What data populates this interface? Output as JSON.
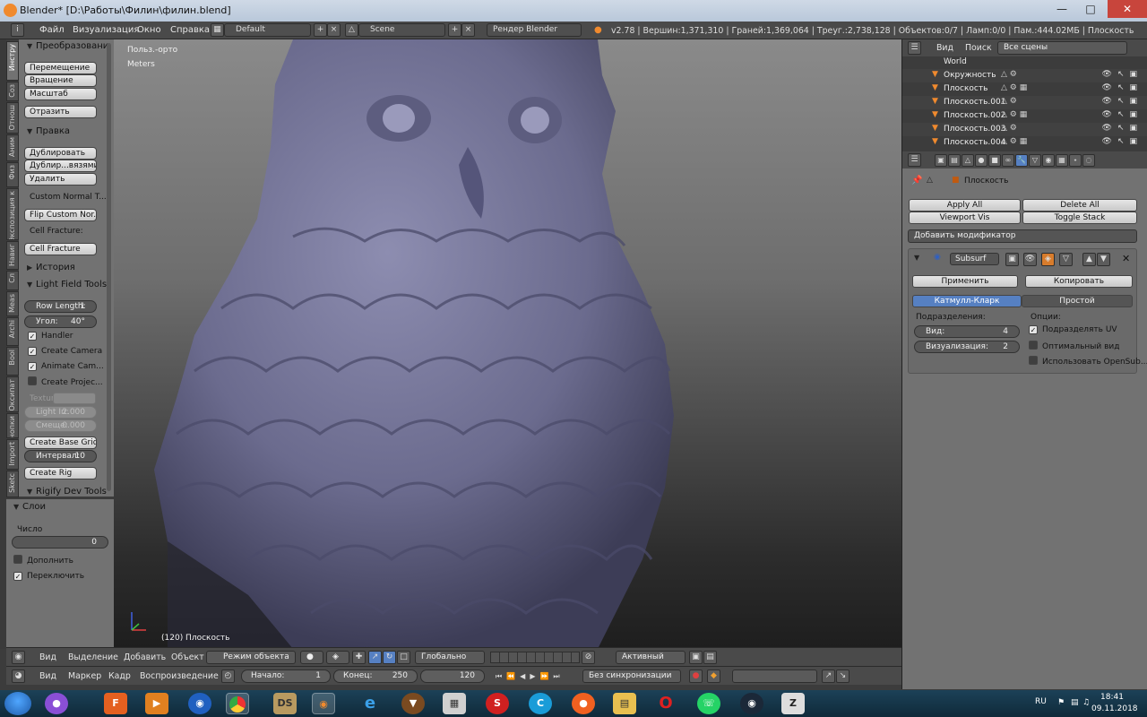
{
  "window": {
    "title": "Blender* [D:\\Работы\\Филин\\филин.blend]"
  },
  "menubar": {
    "items": [
      "Файл",
      "Визуализация",
      "Окно",
      "Справка"
    ],
    "layout": "Default",
    "scene": "Scene",
    "engine": "Рендер Blender",
    "info": "v2.78 | Вершин:1,371,310 | Граней:1,369,064 | Треуг.:2,738,128 | Объектов:0/7 | Ламп:0/0 | Пам.:444.02МБ | Плоскость"
  },
  "tabs": [
    "Инстру",
    "Соз",
    "Отнош",
    "Аним",
    "Физ",
    "Экспозиция к",
    "Навиг",
    "Сл",
    "Meas",
    "Archi",
    "Bool",
    "Оксипат",
    "Кнопки",
    "Import",
    "Sketc"
  ],
  "toolshelf": {
    "transform_header": "Преобразовани",
    "move": "Перемещение",
    "rotate": "Вращение",
    "scale": "Масштаб",
    "mirror": "Отразить",
    "edit_header": "Правка",
    "duplicate": "Дублировать",
    "duplicate_linked": "Дублир...вязями",
    "delete": "Удалить",
    "custom_normal": "Custom Normal T...",
    "flip_normal": "Flip Custom Nor...",
    "cell_fracture_label": "Cell Fracture:",
    "cell_fracture": "Cell Fracture",
    "history_header": "История",
    "lightfield_header": "Light Field Tools",
    "row_length_label": "Row Length:",
    "row_length_value": "1",
    "angle_label": "Угол:",
    "angle_value": "40°",
    "handler": "Handler",
    "create_camera": "Create Camera",
    "animate_camera": "Animate Cam...",
    "create_projector": "Create Projec...",
    "texture_label": "Textur",
    "light_int_label": "Light In:",
    "light_int_value": "2.000",
    "shift_label": "Смеще:",
    "shift_value": "0.000",
    "create_base_grid": "Create Base Grid",
    "interval_label": "Интервал:",
    "interval_value": "10",
    "create_rig": "Create Rig",
    "rigify_header": "Rigify Dev Tools"
  },
  "layers_panel": {
    "header": "Слои",
    "number_label": "Число",
    "number_value": "0",
    "extend": "Дополнить",
    "toggle": "Переключить"
  },
  "viewport": {
    "view_label": "Польз.-орто",
    "units": "Meters",
    "object_label": "(120) Плоскость",
    "mesh_color": "#6f6f93"
  },
  "viewport_header": {
    "menus": [
      "Вид",
      "Выделение",
      "Добавить",
      "Объект"
    ],
    "mode": "Режим объекта",
    "orientation": "Глобально",
    "pivot": "Активный"
  },
  "timeline": {
    "menus": [
      "Вид",
      "Маркер",
      "Кадр",
      "Воспроизведение"
    ],
    "start_label": "Начало:",
    "start_value": "1",
    "end_label": "Конец:",
    "end_value": "250",
    "current_frame": "120",
    "sync": "Без синхронизации"
  },
  "outliner": {
    "menus": [
      "Вид",
      "Поиск"
    ],
    "scope": "Все сцены",
    "items": [
      "World",
      "Окружность",
      "Плоскость",
      "Плоскость.001",
      "Плоскость.002",
      "Плоскость.003",
      "Плоскость.004"
    ]
  },
  "properties": {
    "object_name": "Плоскость",
    "apply_all": "Apply All",
    "delete_all": "Delete All",
    "viewport_vis": "Viewport Vis",
    "toggle_stack": "Toggle Stack",
    "add_modifier": "Добавить модификатор",
    "modifier_name": "Subsurf",
    "apply": "Применить",
    "copy": "Копировать",
    "catmull_clark": "Катмулл-Кларк",
    "simple": "Простой",
    "subdivisions_label": "Подразделения:",
    "view_label": "Вид:",
    "view_value": "4",
    "render_label": "Визуализация:",
    "render_value": "2",
    "options_label": "Опции:",
    "subdivide_uvs": "Подразделять UV",
    "optimal_display": "Оптимальный вид",
    "use_opensubdiv": "Использовать OpenSub..."
  },
  "taskbar": {
    "lang": "RU",
    "time": "18:41",
    "date": "09.11.2018"
  }
}
